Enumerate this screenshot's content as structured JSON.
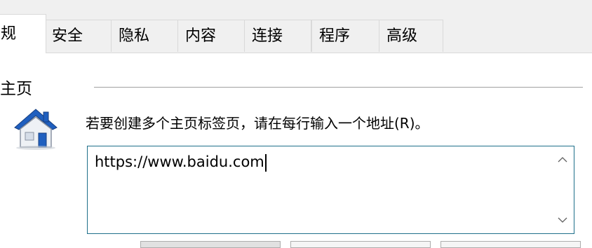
{
  "tabs": [
    {
      "label": "规"
    },
    {
      "label": "安全"
    },
    {
      "label": "隐私"
    },
    {
      "label": "内容"
    },
    {
      "label": "连接"
    },
    {
      "label": "程序"
    },
    {
      "label": "高级"
    }
  ],
  "home_section": {
    "title": "主页",
    "icon": "house-icon",
    "instruction": "若要创建多个主页标签页，请在每行输入一个地址(R)。",
    "urls_value": "https://www.baidu.com"
  },
  "colors": {
    "tab_bg": "#f0f0f0",
    "box_border": "#1e6f8a",
    "house_roof": "#1f5fbf"
  }
}
